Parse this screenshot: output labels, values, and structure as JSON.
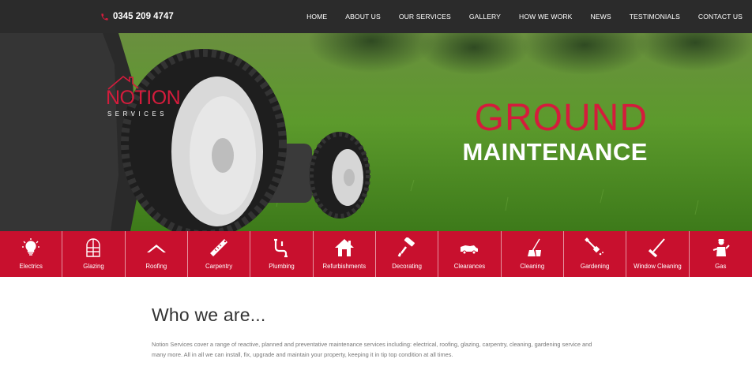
{
  "header": {
    "phone": "0345 209 4747",
    "phone_icon": "phone-icon",
    "nav": [
      "HOME",
      "ABOUT US",
      "OUR SERVICES",
      "GALLERY",
      "HOW WE WORK",
      "NEWS",
      "TESTIMONIALS",
      "CONTACT US"
    ]
  },
  "logo": {
    "word": "NOTION",
    "sub": "SERVICES"
  },
  "hero": {
    "line1": "GROUND",
    "line2": "MAINTENANCE"
  },
  "services": [
    {
      "label": "Electrics",
      "icon": "lightbulb-icon"
    },
    {
      "label": "Glazing",
      "icon": "window-icon"
    },
    {
      "label": "Roofing",
      "icon": "roof-icon"
    },
    {
      "label": "Carpentry",
      "icon": "saw-icon"
    },
    {
      "label": "Plumbing",
      "icon": "pipe-icon"
    },
    {
      "label": "Refurbishments",
      "icon": "house-icon"
    },
    {
      "label": "Decorating",
      "icon": "paint-roller-icon"
    },
    {
      "label": "Clearances",
      "icon": "truck-icon"
    },
    {
      "label": "Cleaning",
      "icon": "mop-bucket-icon"
    },
    {
      "label": "Gardening",
      "icon": "spade-icon"
    },
    {
      "label": "Window Cleaning",
      "icon": "squeegee-icon"
    },
    {
      "label": "Gas",
      "icon": "gas-engineer-icon"
    }
  ],
  "colors": {
    "topbar": "#2b2b2b",
    "accent": "#c8102e",
    "logo_red": "#d41c3c"
  },
  "content": {
    "heading": "Who we are...",
    "intro": "Notion Services cover a range of reactive, planned and preventative maintenance services including: electrical, roofing, glazing, carpentry, cleaning, gardening service and many more. All in all we can install, fix, upgrade and maintain your property, keeping it in tip top condition at all times."
  }
}
